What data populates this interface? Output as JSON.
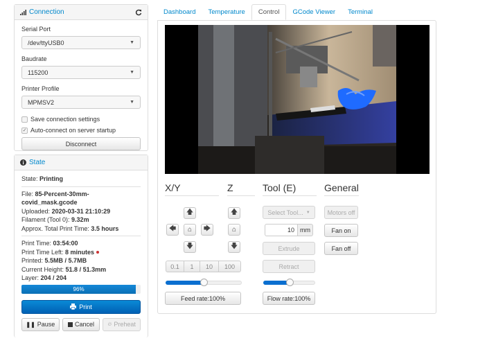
{
  "connection": {
    "title": "Connection",
    "serial_port_label": "Serial Port",
    "serial_port_value": "/dev/ttyUSB0",
    "baudrate_label": "Baudrate",
    "baudrate_value": "115200",
    "profile_label": "Printer Profile",
    "profile_value": "MPMSV2",
    "save_settings_label": "Save connection settings",
    "save_settings_checked": false,
    "autoconnect_label": "Auto-connect on server startup",
    "autoconnect_checked": true,
    "disconnect_label": "Disconnect"
  },
  "state": {
    "title": "State",
    "state_label": "State:",
    "state_value": "Printing",
    "file_label": "File:",
    "file_value_line1": "85-Percent-30mm-",
    "file_value_line2": "covid_mask.gcode",
    "uploaded_label": "Uploaded:",
    "uploaded_value": "2020-03-31 21:10:29",
    "filament_label": "Filament (Tool 0):",
    "filament_value": "9.32m",
    "total_time_label": "Approx. Total Print Time:",
    "total_time_value": "3.5 hours",
    "print_time_label": "Print Time:",
    "print_time_value": "03:54:00",
    "time_left_label": "Print Time Left:",
    "time_left_value": "8 minutes",
    "printed_label": "Printed:",
    "printed_value": "5.5MB / 5.7MB",
    "height_label": "Current Height:",
    "height_value": "51.8 / 51.3mm",
    "layer_label": "Layer:",
    "layer_value": "204 / 204",
    "progress_text": "96%",
    "progress_fraction": 0.96,
    "print_button": "Print",
    "pause_button": "Pause",
    "cancel_button": "Cancel",
    "preheat_button": "Preheat"
  },
  "tabs": [
    "Dashboard",
    "Temperature",
    "Control",
    "GCode Viewer",
    "Terminal"
  ],
  "active_tab": "Control",
  "control": {
    "xy_title": "X/Y",
    "z_title": "Z",
    "tool_title": "Tool (E)",
    "general_title": "General",
    "step_options": [
      "0.1",
      "1",
      "10",
      "100"
    ],
    "feed_rate_label": "Feed rate:100%",
    "feed_rate_fraction": 0.5,
    "tool_select_label": "Select Tool...",
    "extrude_amount": "10",
    "extrude_unit": "mm",
    "extrude_label": "Extrude",
    "retract_label": "Retract",
    "flow_rate_label": "Flow rate:100%",
    "flow_rate_fraction": 0.5,
    "motors_off_label": "Motors off",
    "fan_on_label": "Fan on",
    "fan_off_label": "Fan off"
  },
  "colors": {
    "link": "#0088cc",
    "primary": "#0a6fd0",
    "progress": "#0a6fb5"
  },
  "icons": [
    "signal-icon",
    "refresh-icon",
    "info-icon",
    "print-icon",
    "pause-icon",
    "stop-icon",
    "fire-icon",
    "arrow-up-icon",
    "arrow-down-icon",
    "arrow-left-icon",
    "arrow-right-icon",
    "home-icon"
  ]
}
